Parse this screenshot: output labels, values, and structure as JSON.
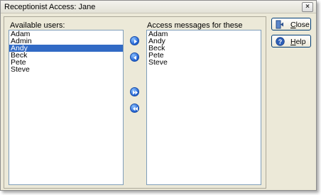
{
  "window": {
    "title": "Receptionist Access: Jane",
    "close_glyph": "×"
  },
  "available": {
    "label": "Available users:",
    "items": [
      "Adam",
      "Admin",
      "Andy",
      "Beck",
      "Pete",
      "Steve"
    ],
    "selected": "Andy"
  },
  "access": {
    "label": "Access messages for these users:",
    "items": [
      "Adam",
      "Andy",
      "Beck",
      "Pete",
      "Steve"
    ]
  },
  "transfer_buttons": [
    {
      "name": "add-arrow-button",
      "icon": "arrow-right-icon"
    },
    {
      "name": "remove-arrow-button",
      "icon": "arrow-left-icon"
    },
    {
      "name": "add-all-arrow-button",
      "icon": "double-arrow-right-icon"
    },
    {
      "name": "remove-all-arrow-button",
      "icon": "double-arrow-left-icon"
    }
  ],
  "buttons": {
    "close": {
      "mnemonic": "C",
      "rest": "lose",
      "icon": "exit-door-icon"
    },
    "help": {
      "mnemonic": "H",
      "rest": "elp",
      "icon": "help-icon"
    }
  },
  "colors": {
    "accent": "#316ac5",
    "dialog_bg": "#ece9d8",
    "arrow_blue": "#1f5fd1"
  }
}
